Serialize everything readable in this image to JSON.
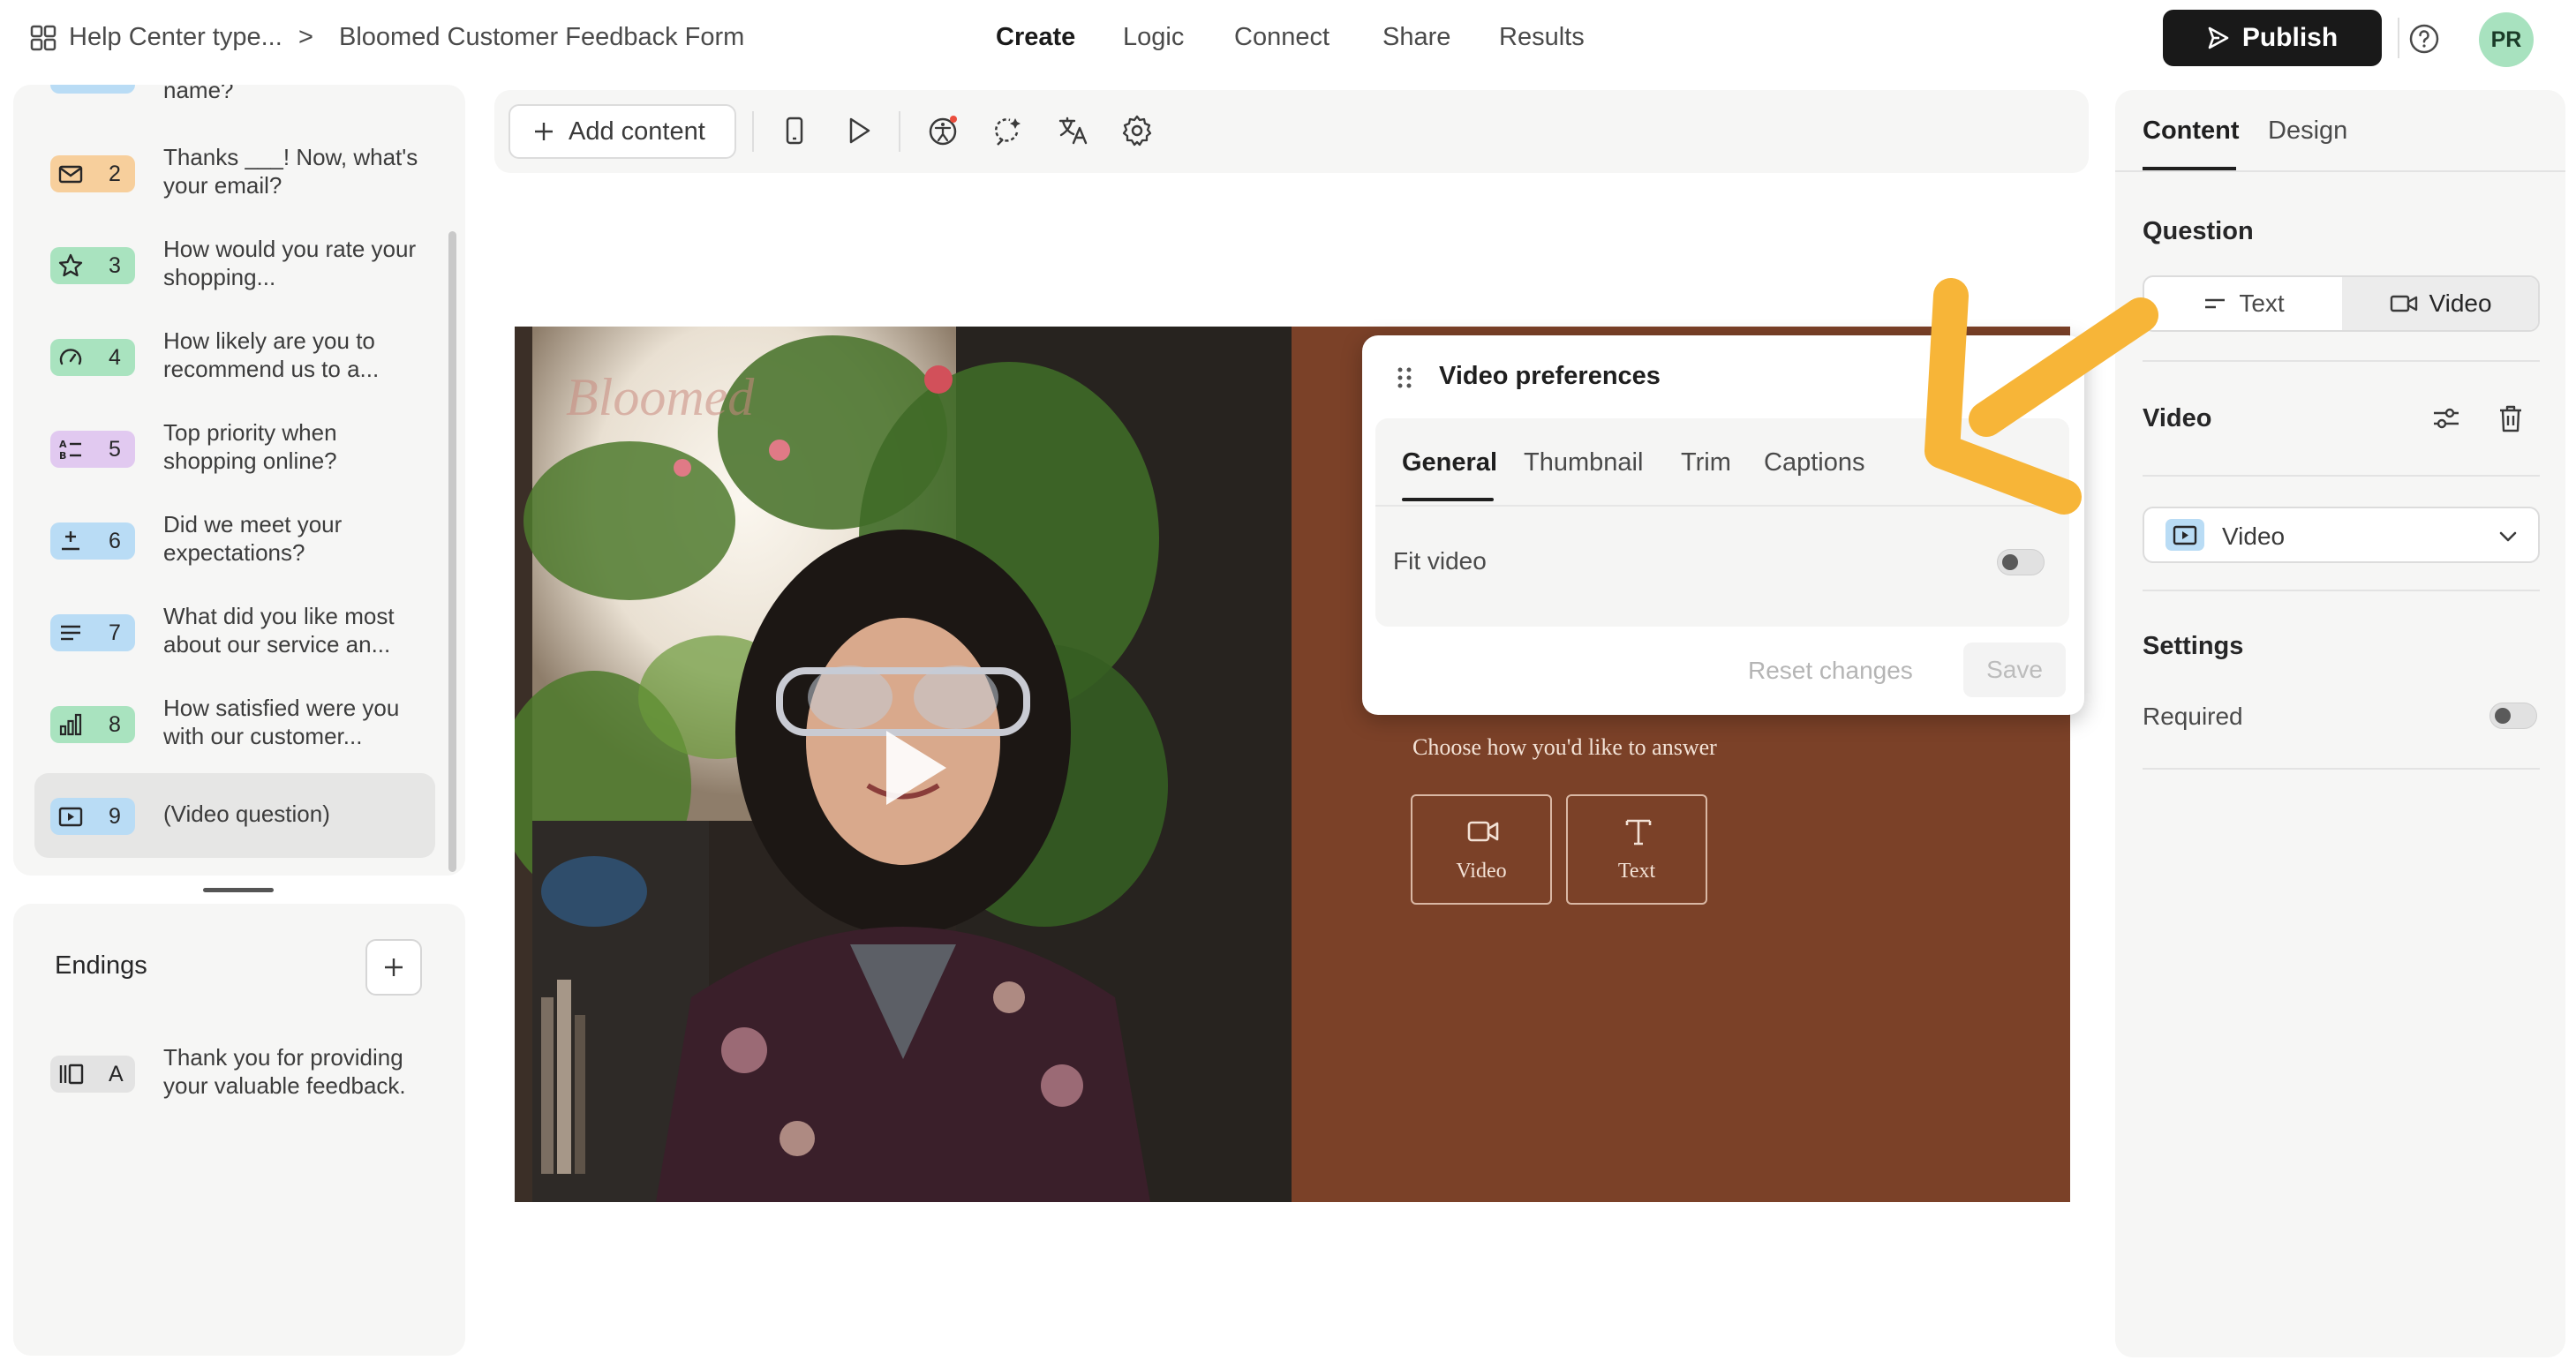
{
  "topbar": {
    "workspace": "Help Center type...",
    "separator": ">",
    "form_title": "Bloomed Customer Feedback Form",
    "nav": [
      "Create",
      "Logic",
      "Connect",
      "Share",
      "Results"
    ],
    "active_nav": "Create",
    "publish_label": "Publish",
    "avatar_initials": "PR"
  },
  "questions": [
    {
      "number": "",
      "text": "name?",
      "icon": "text-icon",
      "color": "#b9dcf5"
    },
    {
      "number": "2",
      "text": "Thanks ___! Now, what's your email?",
      "icon": "mail-icon",
      "color": "#f7cf9c"
    },
    {
      "number": "3",
      "text": "How would you rate your shopping...",
      "icon": "star-icon",
      "color": "#a9e3bf"
    },
    {
      "number": "4",
      "text": "How likely are you to recommend us to a...",
      "icon": "gauge-icon",
      "color": "#a9e3bf"
    },
    {
      "number": "5",
      "text": "Top priority when shopping online?",
      "icon": "ranking-icon",
      "color": "#e1c9f0"
    },
    {
      "number": "6",
      "text": "Did we meet your expectations?",
      "icon": "plus-minus-icon",
      "color": "#b9dcf5"
    },
    {
      "number": "7",
      "text": "What did you like most about our service an...",
      "icon": "long-text-icon",
      "color": "#b9dcf5"
    },
    {
      "number": "8",
      "text": "How satisfied were you with our customer...",
      "icon": "bar-chart-icon",
      "color": "#a9e3bf"
    },
    {
      "number": "9",
      "text": "(Video question)",
      "icon": "video-play-icon",
      "color": "#b9dcf5"
    }
  ],
  "endings": {
    "title": "Endings",
    "items": [
      {
        "letter": "A",
        "text": "Thank you for providing your valuable feedback."
      }
    ]
  },
  "toolbar": {
    "add_content_label": "Add content"
  },
  "canvas": {
    "choose_text": "Choose how you'd like to answer",
    "answer_options": [
      "Video",
      "Text"
    ],
    "brand_color": "#7b4128"
  },
  "video_prefs": {
    "title": "Video preferences",
    "tabs": [
      "General",
      "Thumbnail",
      "Trim",
      "Captions"
    ],
    "active_tab": "General",
    "fit_video_label": "Fit video",
    "fit_video_on": false,
    "reset_label": "Reset changes",
    "save_label": "Save"
  },
  "right_panel": {
    "tabs": [
      "Content",
      "Design"
    ],
    "active_tab": "Content",
    "question_title": "Question",
    "question_types": [
      "Text",
      "Video"
    ],
    "question_type_selected": "Video",
    "video_title": "Video",
    "video_select_value": "Video",
    "settings_title": "Settings",
    "required_label": "Required",
    "required_on": false
  },
  "annotation": {
    "arrow_color": "#f7b538"
  }
}
